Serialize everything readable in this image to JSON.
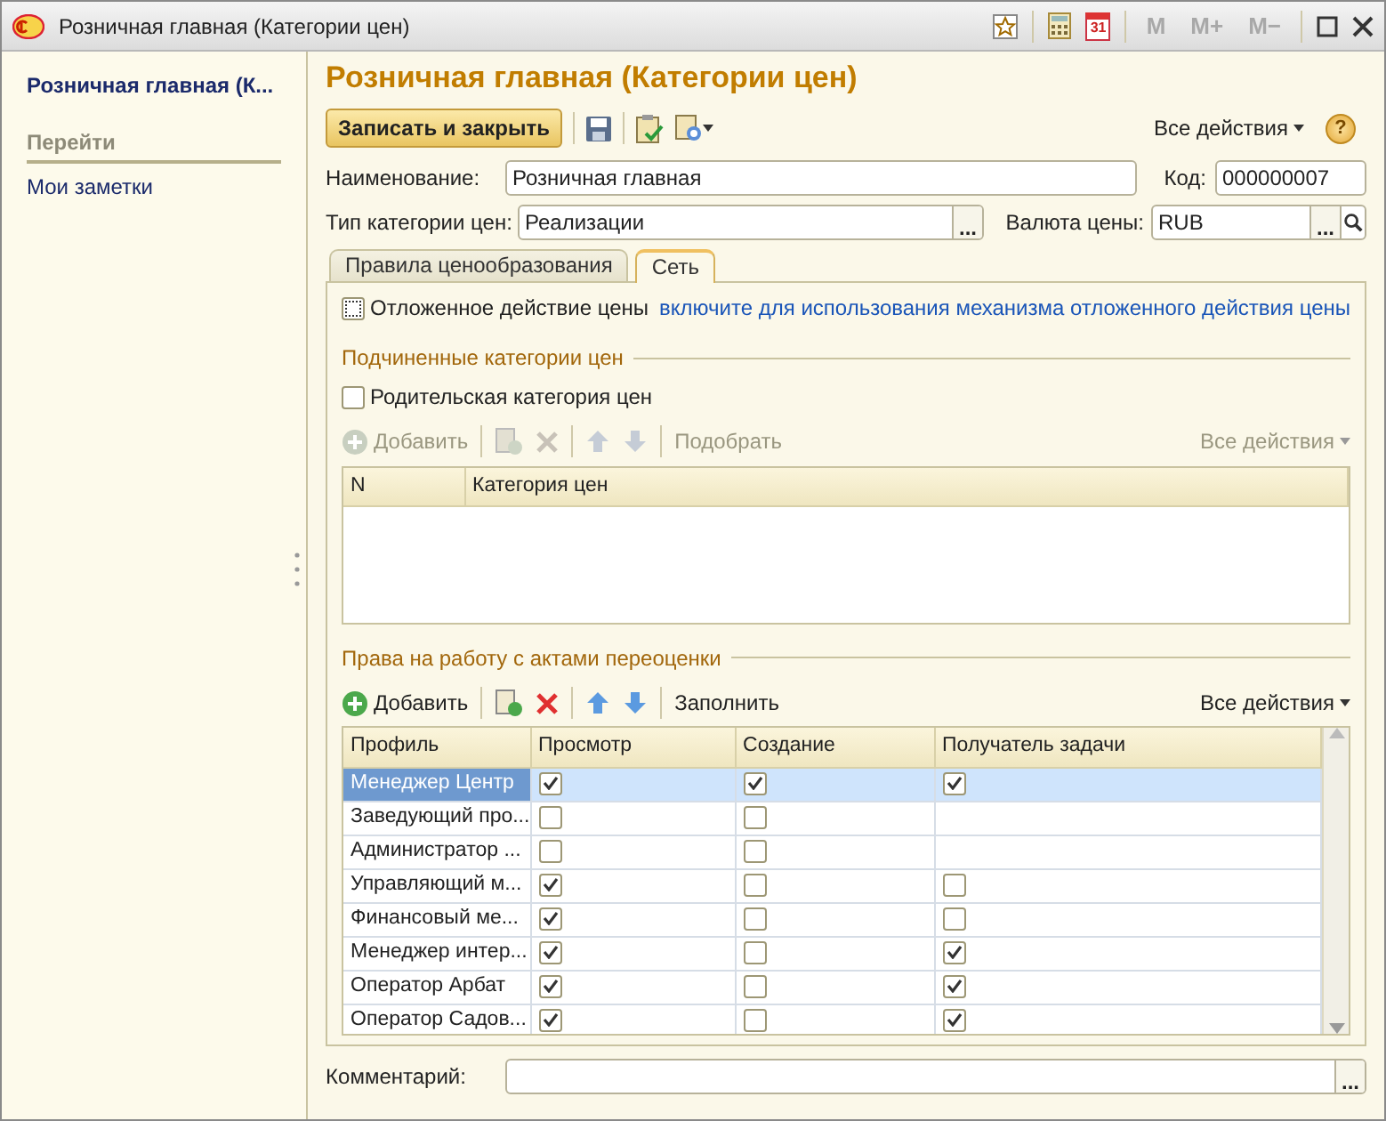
{
  "window": {
    "title": "Розничная главная (Категории цен)",
    "calendar_day": "31",
    "memory_buttons": [
      "M",
      "M+",
      "M−"
    ]
  },
  "sidebar": {
    "title": "Розничная главная (К...",
    "section": "Перейти",
    "items": [
      "Мои заметки"
    ]
  },
  "form": {
    "heading": "Розничная главная (Категории цен)",
    "toolbar": {
      "save_button": "Записать и закрыть",
      "all_actions": "Все действия",
      "help": "?"
    },
    "fields": [
      {
        "label": "Наименование:",
        "value": "Розничная главная"
      },
      {
        "label": "Код:",
        "value": "000000007"
      },
      {
        "label": "Тип категории цен:",
        "value": "Реализации",
        "choice_button": "..."
      },
      {
        "label": "Валюта цены:",
        "value": "RUB",
        "choice_button": "..."
      }
    ],
    "tabs": [
      {
        "label": "Правила ценообразования",
        "selected": false
      },
      {
        "label": "Сеть",
        "selected": true
      }
    ],
    "deferred": {
      "label": "Отложенное действие цены",
      "checked": false,
      "link": "включите для использования механизма отложенного действия цены"
    },
    "sub_categories": {
      "title": "Подчиненные категории цен",
      "parent_checkbox": {
        "label": "Родительская категория цен",
        "checked": false
      },
      "toolbar": {
        "disabled": true,
        "add": "Добавить",
        "extra": "Подобрать",
        "all_actions": "Все действия"
      },
      "columns": [
        "N",
        "Категория цен"
      ]
    },
    "rights": {
      "title": "Права на работу с актами переоценки",
      "toolbar": {
        "disabled": false,
        "add": "Добавить",
        "extra": "Заполнить",
        "all_actions": "Все действия"
      },
      "columns": [
        "Профиль",
        "Просмотр",
        "Создание",
        "Получатель задачи"
      ],
      "rows": [
        {
          "profile": "Менеджер Центр",
          "view": true,
          "create": true,
          "recipient": true,
          "selected": true
        },
        {
          "profile": "Заведующий про...",
          "view": false,
          "create": false,
          "selected": false
        },
        {
          "profile": "Администратор ...",
          "view": false,
          "create": false,
          "selected": false
        },
        {
          "profile": "Управляющий м...",
          "view": true,
          "create": false,
          "recipient": false,
          "selected": false
        },
        {
          "profile": "Финансовый ме...",
          "view": true,
          "create": false,
          "recipient": false,
          "selected": false
        },
        {
          "profile": "Менеджер интер...",
          "view": true,
          "create": false,
          "recipient": true,
          "selected": false
        },
        {
          "profile": "Оператор Арбат",
          "view": true,
          "create": false,
          "recipient": true,
          "selected": false
        },
        {
          "profile": "Оператор Садов...",
          "view": true,
          "create": false,
          "recipient": true,
          "selected": false
        }
      ]
    },
    "comment": {
      "label": "Комментарий:",
      "choice_button": "..."
    }
  }
}
